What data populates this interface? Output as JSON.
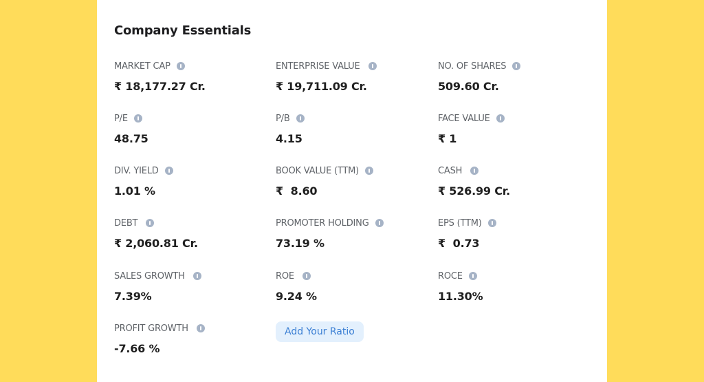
{
  "page": {
    "background_color": "#FFDC5A",
    "card_color": "#FFFFFF",
    "accent_color": "#3B7FD4"
  },
  "card": {
    "title": "Company Essentials",
    "metrics": [
      {
        "label": "MARKET CAP",
        "value": "₹ 18,177.27 Cr.",
        "icon": "info-icon"
      },
      {
        "label": "ENTERPRISE VALUE",
        "value": "₹ 19,711.09 Cr.",
        "icon": "info-icon"
      },
      {
        "label": "NO. OF SHARES",
        "value": "509.60 Cr.",
        "icon": "info-icon"
      },
      {
        "label": "P/E",
        "value": "48.75",
        "icon": "info-icon"
      },
      {
        "label": "P/B",
        "value": "4.15",
        "icon": "info-icon"
      },
      {
        "label": "FACE VALUE",
        "value": "₹ 1",
        "icon": "info-icon"
      },
      {
        "label": "DIV. YIELD",
        "value": "1.01 %",
        "icon": "info-icon"
      },
      {
        "label": "BOOK VALUE (TTM)",
        "value": "₹  8.60",
        "icon": "info-icon"
      },
      {
        "label": "CASH",
        "value": "₹ 526.99 Cr.",
        "icon": "info-icon"
      },
      {
        "label": "DEBT",
        "value": "₹ 2,060.81 Cr.",
        "icon": "info-icon"
      },
      {
        "label": "PROMOTER HOLDING",
        "value": "73.19 %",
        "icon": "info-icon"
      },
      {
        "label": "EPS (TTM)",
        "value": "₹  0.73",
        "icon": "info-icon"
      },
      {
        "label": "SALES GROWTH",
        "value": "7.39%",
        "icon": "info-icon"
      },
      {
        "label": "ROE",
        "value": "9.24 %",
        "icon": "info-icon"
      },
      {
        "label": "ROCE",
        "value": "11.30%",
        "icon": "info-icon"
      },
      {
        "label": "PROFIT GROWTH",
        "value": "-7.66 %",
        "icon": "info-icon"
      }
    ],
    "add_ratio_label": "Add Your Ratio"
  }
}
